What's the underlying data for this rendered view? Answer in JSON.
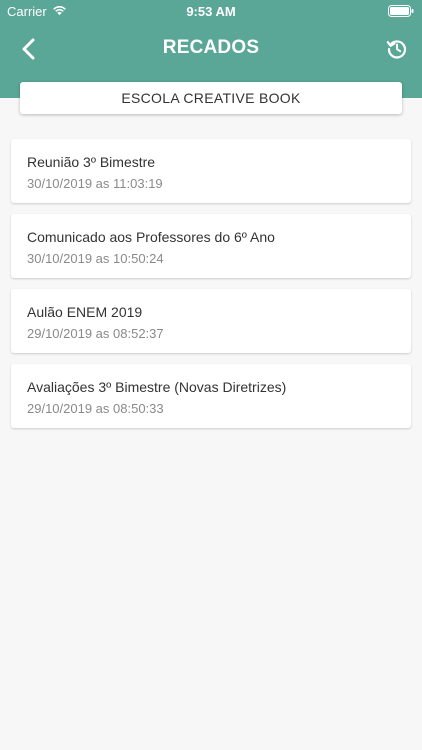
{
  "status_bar": {
    "carrier": "Carrier",
    "time": "9:53 AM"
  },
  "header": {
    "title": "RECADOS",
    "background_color": "#5aa697",
    "back_icon": "chevron-left-icon",
    "refresh_icon": "history-refresh-icon"
  },
  "school": {
    "name": "ESCOLA CREATIVE BOOK"
  },
  "messages": [
    {
      "title": "Reunião 3º Bimestre",
      "date": "30/10/2019 as 11:03:19"
    },
    {
      "title": "Comunicado aos Professores do 6º Ano",
      "date": "30/10/2019 as 10:50:24"
    },
    {
      "title": "Aulão ENEM 2019",
      "date": "29/10/2019 as 08:52:37"
    },
    {
      "title": "Avaliações 3º Bimestre (Novas Diretrizes)",
      "date": "29/10/2019 as 08:50:33"
    }
  ]
}
